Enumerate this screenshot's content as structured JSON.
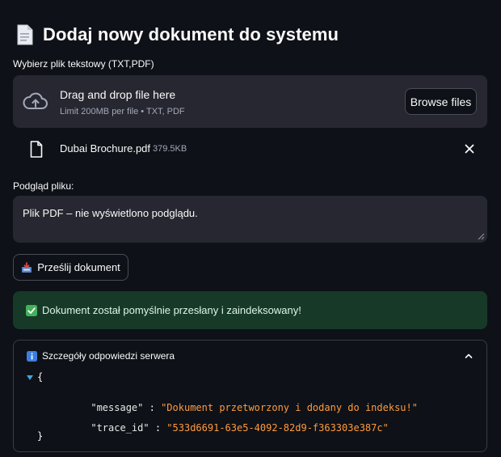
{
  "title": "Dodaj nowy dokument do systemu",
  "uploader": {
    "label": "Wybierz plik tekstowy (TXT,PDF)",
    "drop_text": "Drag and drop file here",
    "limit_text": "Limit 200MB per file • TXT, PDF",
    "browse_label": "Browse files"
  },
  "file": {
    "name": "Dubai Brochure.pdf",
    "size": "379.5KB"
  },
  "preview": {
    "label": "Podgląd pliku:",
    "value": "Plik PDF – nie wyświetlono podglądu."
  },
  "submit": {
    "label": "Prześlij dokument"
  },
  "success": {
    "message": "Dokument został pomyślnie przesłany i zaindeksowany!"
  },
  "expander": {
    "title": "Szczegóły odpowiedzi serwera",
    "json": {
      "open_brace": "{",
      "close_brace": "}",
      "entries": [
        {
          "key": "\"message\"",
          "value": "\"Dokument przetworzony i dodany do indeksu!\""
        },
        {
          "key": "\"trace_id\"",
          "value": "\"533d6691-63e5-4092-82d9-f363303e387c\""
        }
      ]
    }
  },
  "colors": {
    "background": "#0e1117",
    "surface": "#262730",
    "success_bg": "#173928",
    "json_string": "#ff9b3e",
    "tree_toggle": "#3fa7e0"
  },
  "icons": {
    "title": "document-icon",
    "dropzone": "cloud-upload-icon",
    "file": "file-icon",
    "remove": "close-icon",
    "submit": "inbox-tray-icon",
    "success": "check-mark-icon",
    "expander": "info-icon",
    "collapse": "chevron-up-icon"
  }
}
